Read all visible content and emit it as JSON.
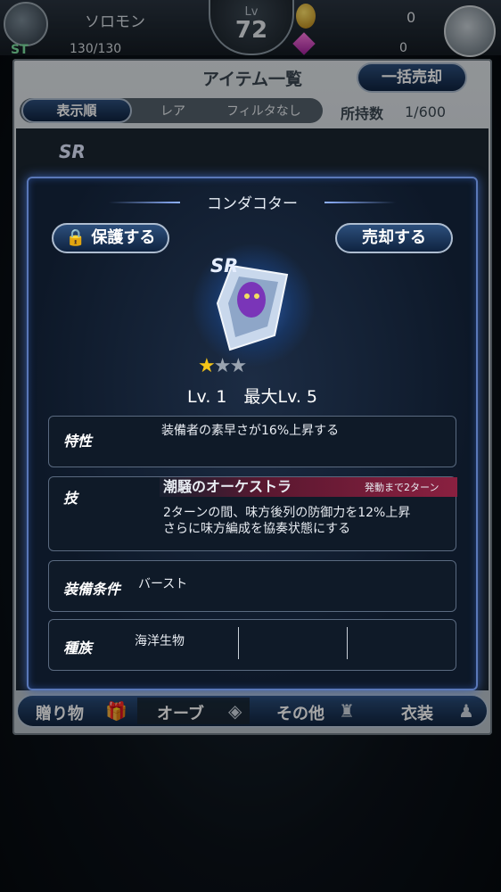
{
  "status": {
    "player_name": "ソロモン",
    "st_label": "ST",
    "st_value": "130/130",
    "lv_label": "Lv",
    "lv_value": "72",
    "coins": "0",
    "gems": "0"
  },
  "window": {
    "title": "アイテム一覧",
    "bulk_sell": "一括売却",
    "sort_label": "表示順",
    "sort_rare": "レア",
    "filter": "フィルタなし",
    "owned_label": "所持数",
    "owned_value": "1/600",
    "list_rarity": "SR"
  },
  "tabs": [
    {
      "label": "贈り物",
      "icon": "gift-icon"
    },
    {
      "label": "オーブ",
      "icon": "orb-icon"
    },
    {
      "label": "その他",
      "icon": "bag-icon"
    },
    {
      "label": "衣装",
      "icon": "outfit-icon"
    }
  ],
  "item": {
    "name": "コンダコター",
    "protect_button": "保護する",
    "sell_button": "売却する",
    "rarity": "SR",
    "star_rating": 1,
    "star_max": 3,
    "level_line": "Lv. 1　最大Lv. 5",
    "trait_label": "特性",
    "trait_text": "装備者の素早さが16%上昇する",
    "skill_label": "技",
    "skill_name": "潮騒のオーケストラ",
    "skill_cooldown": "発動まで2ターン",
    "skill_desc_1": "2ターンの間、味方後列の防御力を12%上昇",
    "skill_desc_2": "さらに味方編成を協奏状態にする",
    "equip_label": "装備条件",
    "equip_value": "バースト",
    "race_label": "種族",
    "race_value": "海洋生物"
  },
  "colors": {
    "accent": "#2d4f7c",
    "skill_bar": "#8a2040",
    "star": "#f5c518"
  }
}
